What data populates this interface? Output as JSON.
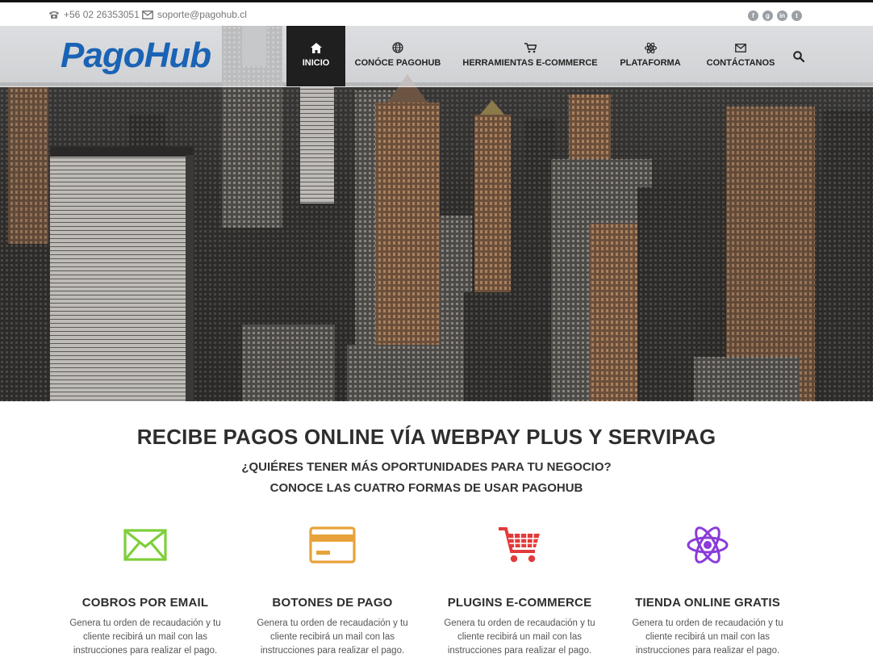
{
  "topbar": {
    "phone": "+56 02 26353051",
    "email": "soporte@pagohub.cl",
    "phone_icon": "phone-icon",
    "email_icon": "envelope-icon",
    "socials": [
      {
        "name": "facebook-icon",
        "glyph": "f"
      },
      {
        "name": "google-plus-icon",
        "glyph": "g"
      },
      {
        "name": "linkedin-icon",
        "glyph": "in"
      },
      {
        "name": "twitter-icon",
        "glyph": "t"
      }
    ]
  },
  "header": {
    "logo_text": "PagoHub",
    "nav": [
      {
        "label": "INICIO",
        "icon": "home-icon",
        "active": true
      },
      {
        "label": "CONÓCE PAGOHUB",
        "icon": "globe-icon",
        "active": false
      },
      {
        "label": "HERRAMIENTAS E-COMMERCE",
        "icon": "cart-icon",
        "active": false
      },
      {
        "label": "PLATAFORMA",
        "icon": "atom-icon",
        "active": false
      },
      {
        "label": "CONTÁCTANOS",
        "icon": "envelope-icon",
        "active": false
      }
    ],
    "search_icon": "search-icon"
  },
  "hero": {
    "image": "city-skyline-photo"
  },
  "main": {
    "headline": "RECIBE PAGOS ONLINE VÍA WEBPAY PLUS Y SERVIPAG",
    "subheadline_1": "¿QUIÉRES TENER MÁS OPORTUNIDADES PARA TU NEGOCIO?",
    "subheadline_2": "CONOCE LAS CUATRO FORMAS DE USAR PAGOHUB",
    "features": [
      {
        "title": "COBROS POR EMAIL",
        "desc": "Genera tu orden de recaudación y tu cliente recibirá un mail con las instrucciones para realizar el pago.",
        "icon": "envelope-icon",
        "color": "#7dcf3a"
      },
      {
        "title": "BOTONES DE PAGO",
        "desc": "Genera tu orden de recaudación y tu cliente recibirá un mail con las instrucciones para realizar el pago.",
        "icon": "credit-card-icon",
        "color": "#e8a23a"
      },
      {
        "title": "PLUGINS E-COMMERCE",
        "desc": "Genera tu orden de recaudación y tu cliente recibirá un mail con las instrucciones para realizar el pago.",
        "icon": "cart-icon",
        "color": "#e23b3b"
      },
      {
        "title": "TIENDA ONLINE GRATIS",
        "desc": "Genera tu orden de recaudación y tu cliente recibirá un mail con las instrucciones para realizar el pago.",
        "icon": "atom-icon",
        "color": "#8a3bd9"
      }
    ]
  }
}
